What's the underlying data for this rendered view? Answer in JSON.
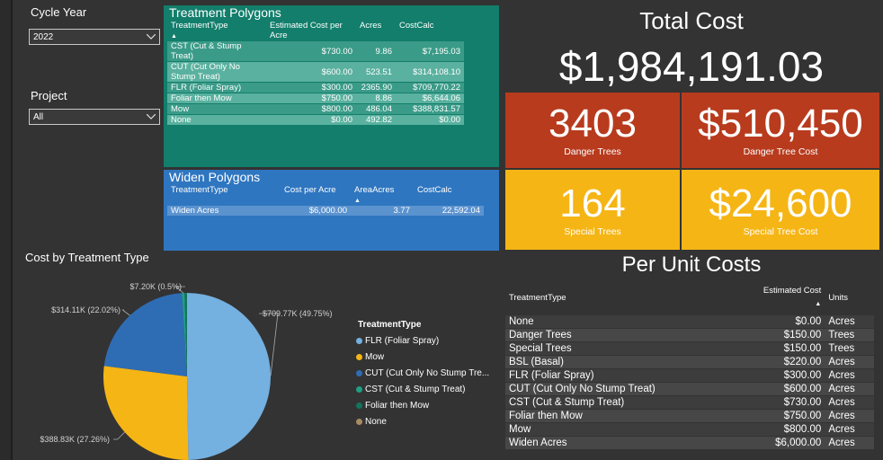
{
  "slicers": {
    "cycle_year": {
      "title": "Cycle Year",
      "value": "2022"
    },
    "project": {
      "title": "Project",
      "value": "All"
    }
  },
  "treatment_polygons": {
    "title": "Treatment Polygons",
    "headers": [
      "TreatmentType",
      "Estimated Cost per Acre",
      "Acres",
      "CostCalc"
    ],
    "rows": [
      [
        "CST (Cut & Stump Treat)",
        "$730.00",
        "9.86",
        "$7,195.03"
      ],
      [
        "CUT (Cut Only No Stump Treat)",
        "$600.00",
        "523.51",
        "$314,108.10"
      ],
      [
        "FLR (Foliar Spray)",
        "$300.00",
        "2365.90",
        "$709,770.22"
      ],
      [
        "Foliar then Mow",
        "$750.00",
        "8.86",
        "$6,644.06"
      ],
      [
        "Mow",
        "$800.00",
        "486.04",
        "$388,831.57"
      ],
      [
        "None",
        "$0.00",
        "492.82",
        "$0.00"
      ]
    ]
  },
  "widen_polygons": {
    "title": "Widen Polygons",
    "headers": [
      "TreatmentType",
      "Cost per Acre",
      "AreaAcres",
      "CostCalc"
    ],
    "rows": [
      [
        "Widen Acres",
        "$6,000.00",
        "3.77",
        "22,592.04"
      ]
    ]
  },
  "total": {
    "title": "Total Cost",
    "value": "$1,984,191.03"
  },
  "kpis": {
    "danger_trees": {
      "value": "3403",
      "label": "Danger Trees"
    },
    "danger_tree_cost": {
      "value": "$510,450",
      "label": "Danger Tree Cost"
    },
    "special_trees": {
      "value": "164",
      "label": "Special Trees"
    },
    "special_tree_cost": {
      "value": "$24,600",
      "label": "Special Tree Cost"
    }
  },
  "pie": {
    "title": "Cost by Treatment Type",
    "legend_title": "TreatmentType",
    "legend": [
      {
        "label": "FLR (Foliar Spray)",
        "color": "#74b0e0"
      },
      {
        "label": "Mow",
        "color": "#f5b515"
      },
      {
        "label": "CUT (Cut Only No Stump Tre...",
        "color": "#2e6db4"
      },
      {
        "label": "CST (Cut & Stump Treat)",
        "color": "#1fa085"
      },
      {
        "label": "Foliar then Mow",
        "color": "#137560"
      },
      {
        "label": "None",
        "color": "#a88b62"
      }
    ]
  },
  "chart_data": {
    "type": "pie",
    "title": "Cost by Treatment Type",
    "slices": [
      {
        "name": "FLR (Foliar Spray)",
        "value": 709.77,
        "percent": 49.75,
        "label": "$709.77K (49.75%)",
        "color": "#74b0e0"
      },
      {
        "name": "Mow",
        "value": 388.83,
        "percent": 27.26,
        "label": "$388.83K (27.26%)",
        "color": "#f5b515"
      },
      {
        "name": "CUT (Cut Only No Stump Treat)",
        "value": 314.11,
        "percent": 22.02,
        "label": "$314.11K (22.02%)",
        "color": "#2e6db4"
      },
      {
        "name": "CST (Cut & Stump Treat)",
        "value": 7.2,
        "percent": 0.5,
        "label": "$7.20K (0.5%)",
        "color": "#1fa085"
      },
      {
        "name": "Foliar then Mow",
        "value": 6.64,
        "percent": 0.47,
        "label": "",
        "color": "#137560"
      },
      {
        "name": "None",
        "value": 0,
        "percent": 0,
        "label": "",
        "color": "#a88b62"
      }
    ],
    "legend": "right"
  },
  "per_unit": {
    "title": "Per Unit Costs",
    "headers": [
      "TreatmentType",
      "Estimated Cost",
      "Units"
    ],
    "rows": [
      [
        "None",
        "$0.00",
        "Acres"
      ],
      [
        "Danger Trees",
        "$150.00",
        "Trees"
      ],
      [
        "Special Trees",
        "$150.00",
        "Trees"
      ],
      [
        "BSL (Basal)",
        "$220.00",
        "Acres"
      ],
      [
        "FLR (Foliar Spray)",
        "$300.00",
        "Acres"
      ],
      [
        "CUT (Cut Only No Stump Treat)",
        "$600.00",
        "Acres"
      ],
      [
        "CST (Cut & Stump Treat)",
        "$730.00",
        "Acres"
      ],
      [
        "Foliar then Mow",
        "$750.00",
        "Acres"
      ],
      [
        "Mow",
        "$800.00",
        "Acres"
      ],
      [
        "Widen Acres",
        "$6,000.00",
        "Acres"
      ]
    ]
  }
}
